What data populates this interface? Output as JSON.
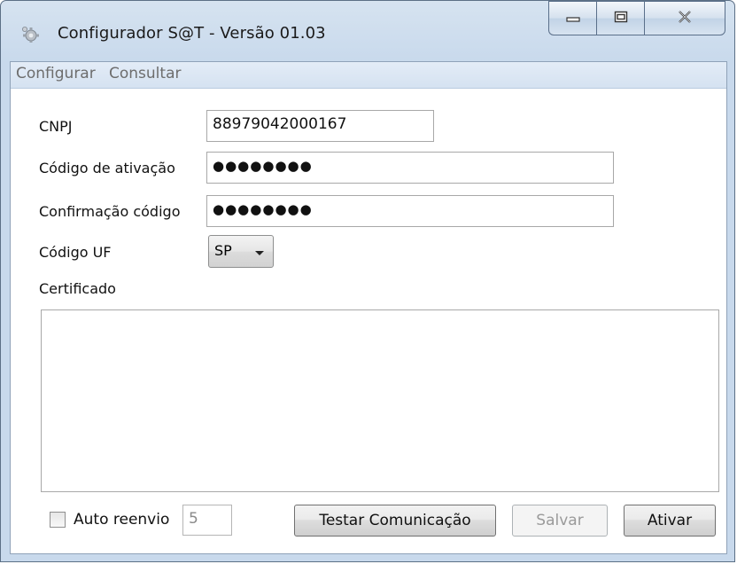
{
  "window": {
    "title": "Configurador S@T - Versão 01.03",
    "icons": {
      "app": "gear-app-icon",
      "minimize": "minimize-icon",
      "maximize": "restore-icon",
      "close": "close-icon"
    }
  },
  "menu": {
    "items": [
      {
        "label": "Configurar"
      },
      {
        "label": "Consultar"
      }
    ]
  },
  "form": {
    "cnpj_label": "CNPJ",
    "cnpj_value": "88979042000167",
    "activation_label": "Código de ativação",
    "activation_value": "●●●●●●●●",
    "confirm_label": "Confirmação código",
    "confirm_value": "●●●●●●●●",
    "uf_label": "Código UF",
    "uf_value": "SP",
    "certificate_label": "Certificado",
    "certificate_value": ""
  },
  "footer": {
    "auto_resend_label": "Auto reenvio",
    "auto_resend_checked": false,
    "auto_resend_value": "5",
    "test_button": "Testar Comunicação",
    "save_button": "Salvar",
    "save_enabled": false,
    "activate_button": "Ativar"
  },
  "colors": {
    "frame": "#c8d9ec",
    "menu_text": "#6d6d6d",
    "disabled_text": "#9a9a9a"
  }
}
